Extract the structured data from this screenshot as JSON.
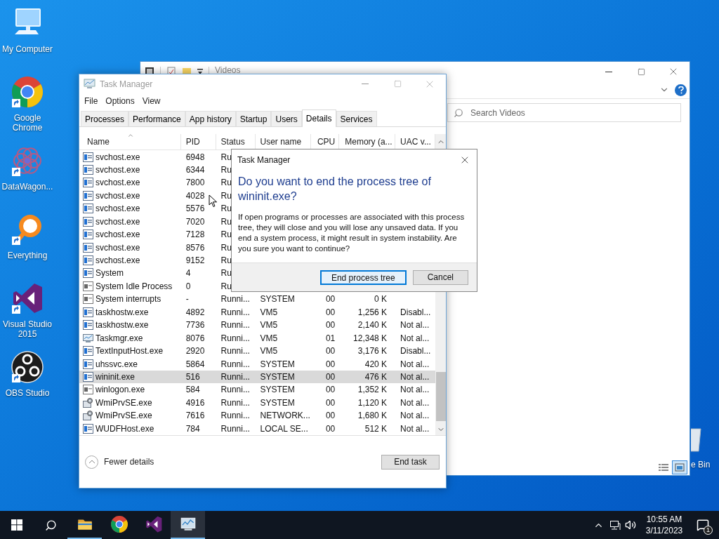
{
  "desktop_icons": [
    {
      "kind": "monitor",
      "label": "My Computer",
      "shortcut": false
    },
    {
      "kind": "browser",
      "label": "Google Chrome",
      "shortcut": true
    },
    {
      "kind": "flower",
      "label": "DataWagon...",
      "shortcut": true
    },
    {
      "kind": "ring",
      "label": "Everything",
      "shortcut": true
    },
    {
      "kind": "bowtie",
      "label": "Visual Studio 2015",
      "shortcut": true
    },
    {
      "kind": "disc",
      "label": "OBS Studio",
      "shortcut": true
    }
  ],
  "recycle_bin": {
    "label": "e Bin"
  },
  "explorer": {
    "title": "Videos",
    "search": {
      "placeholder": "Search Videos"
    }
  },
  "task_manager": {
    "title": "Task Manager",
    "menu": [
      "File",
      "Options",
      "View"
    ],
    "tabs": [
      {
        "label": "Processes",
        "selected": false
      },
      {
        "label": "Performance",
        "selected": false
      },
      {
        "label": "App history",
        "selected": false
      },
      {
        "label": "Startup",
        "selected": false
      },
      {
        "label": "Users",
        "selected": false
      },
      {
        "label": "Details",
        "selected": true
      },
      {
        "label": "Services",
        "selected": false
      }
    ],
    "columns": [
      "Name",
      "PID",
      "Status",
      "User name",
      "CPU",
      "Memory (a...",
      "UAC v..."
    ],
    "rows": [
      {
        "kind": "window",
        "name": "svchost.exe",
        "pid": "6948",
        "status": "Ru",
        "selected": false
      },
      {
        "kind": "window",
        "name": "svchost.exe",
        "pid": "6344",
        "status": "Ru",
        "selected": false
      },
      {
        "kind": "window",
        "name": "svchost.exe",
        "pid": "7800",
        "status": "Ru",
        "selected": false
      },
      {
        "kind": "window",
        "name": "svchost.exe",
        "pid": "4028",
        "status": "Ru",
        "selected": false
      },
      {
        "kind": "window",
        "name": "svchost.exe",
        "pid": "5576",
        "status": "Ru",
        "selected": false
      },
      {
        "kind": "window",
        "name": "svchost.exe",
        "pid": "7020",
        "status": "Ru",
        "selected": false
      },
      {
        "kind": "window",
        "name": "svchost.exe",
        "pid": "7128",
        "status": "Ru",
        "selected": false
      },
      {
        "kind": "window",
        "name": "svchost.exe",
        "pid": "8576",
        "status": "Ru",
        "selected": false
      },
      {
        "kind": "window",
        "name": "svchost.exe",
        "pid": "9152",
        "status": "Ru",
        "selected": false
      },
      {
        "kind": "window",
        "name": "System",
        "pid": "4",
        "status": "Ru",
        "selected": false
      },
      {
        "kind": "plain",
        "name": "System Idle Process",
        "pid": "0",
        "status": "Ru",
        "selected": false
      },
      {
        "kind": "plain",
        "name": "System interrupts",
        "pid": "-",
        "status": "Runni...",
        "user": "SYSTEM",
        "cpu": "00",
        "memory": "0 K",
        "selected": false
      },
      {
        "kind": "window",
        "name": "taskhostw.exe",
        "pid": "4892",
        "status": "Runni...",
        "user": "VM5",
        "cpu": "00",
        "memory": "1,256 K",
        "uac": "Disabl...",
        "selected": false
      },
      {
        "kind": "window",
        "name": "taskhostw.exe",
        "pid": "7736",
        "status": "Runni...",
        "user": "VM5",
        "cpu": "00",
        "memory": "2,140 K",
        "uac": "Not al...",
        "selected": false
      },
      {
        "kind": "monitor",
        "name": "Taskmgr.exe",
        "pid": "8076",
        "status": "Runni...",
        "user": "VM5",
        "cpu": "01",
        "memory": "12,348 K",
        "uac": "Not al...",
        "selected": false
      },
      {
        "kind": "window",
        "name": "TextInputHost.exe",
        "pid": "2920",
        "status": "Runni...",
        "user": "VM5",
        "cpu": "00",
        "memory": "3,176 K",
        "uac": "Disabl...",
        "selected": false
      },
      {
        "kind": "window",
        "name": "uhssvc.exe",
        "pid": "5864",
        "status": "Runni...",
        "user": "SYSTEM",
        "cpu": "00",
        "memory": "420 K",
        "uac": "Not al...",
        "selected": false
      },
      {
        "kind": "window",
        "name": "wininit.exe",
        "pid": "516",
        "status": "Runni...",
        "user": "SYSTEM",
        "cpu": "00",
        "memory": "476 K",
        "uac": "Not al...",
        "selected": true
      },
      {
        "kind": "plain",
        "name": "winlogon.exe",
        "pid": "584",
        "status": "Runni...",
        "user": "SYSTEM",
        "cpu": "00",
        "memory": "1,352 K",
        "uac": "Not al...",
        "selected": false
      },
      {
        "kind": "gears",
        "name": "WmiPrvSE.exe",
        "pid": "4916",
        "status": "Runni...",
        "user": "SYSTEM",
        "cpu": "00",
        "memory": "1,120 K",
        "uac": "Not al...",
        "selected": false
      },
      {
        "kind": "gears",
        "name": "WmiPrvSE.exe",
        "pid": "7616",
        "status": "Runni...",
        "user": "NETWORK...",
        "cpu": "00",
        "memory": "1,680 K",
        "uac": "Not al...",
        "selected": false
      },
      {
        "kind": "window",
        "name": "WUDFHost.exe",
        "pid": "784",
        "status": "Runni...",
        "user": "LOCAL SE...",
        "cpu": "00",
        "memory": "512 K",
        "uac": "Not al...",
        "selected": false
      }
    ],
    "footer": {
      "toggle": "Fewer details",
      "button": "End task"
    }
  },
  "dialog": {
    "title": "Task Manager",
    "heading": "Do you want to end the process tree of wininit.exe?",
    "message": "If open programs or processes are associated with this process tree, they will close and you will lose any unsaved data. If you end a system process, it might result in system instability. Are you sure you want to continue?",
    "buttons": [
      {
        "label": "End process tree",
        "default": true
      },
      {
        "label": "Cancel",
        "default": false
      }
    ]
  },
  "taskbar": {
    "apps": [
      {
        "kind": "folder",
        "running": true,
        "selected": false
      },
      {
        "kind": "browser",
        "running": false,
        "selected": false
      },
      {
        "kind": "bowtie",
        "running": false,
        "selected": false
      },
      {
        "kind": "taskmgr",
        "running": true,
        "selected": true
      }
    ],
    "clock": {
      "time": "10:55 AM",
      "date": "3/11/2023"
    },
    "notifications": "1"
  }
}
